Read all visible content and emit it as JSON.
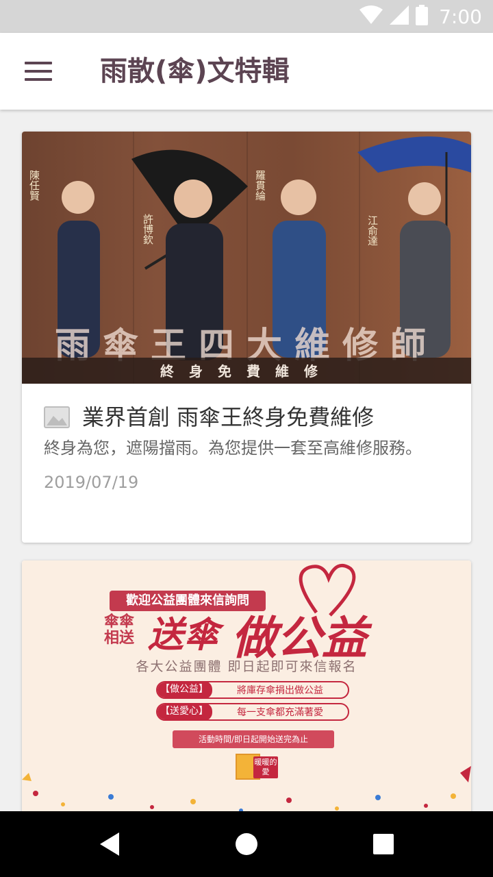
{
  "status_bar": {
    "time": "7:00",
    "icons": [
      "wifi-icon",
      "cellular-signal-icon",
      "battery-icon"
    ]
  },
  "app_bar": {
    "title": "雨散(傘)文特輯",
    "menu_icon": "hamburger-menu-icon"
  },
  "cards": [
    {
      "image_text": {
        "banner": "雨傘王四大維修師",
        "subtitle": "終身免費維修",
        "names": [
          "陳任賢",
          "許博欽",
          "羅貫綸",
          "江俞達"
        ]
      },
      "icon": "image-icon",
      "title": "業界首創 雨傘王終身免費維修",
      "description": "終身為您，遮陽擋雨。為您提供一套至高維修服務。",
      "date": "2019/07/19"
    },
    {
      "image_text": {
        "line1": "歡迎公益團體來信詢問",
        "small": "傘傘相送",
        "big1": "送傘",
        "big2": "做公益",
        "sub": "各大公益團體 即日起即可來信報名",
        "row1_tag": "【做公益】",
        "row1_text": "將庫存傘捐出做公益",
        "row2_tag": "【送愛心】",
        "row2_text": "每一支傘都充滿著愛",
        "ribbon": "活動時間/即日起開始送完為止",
        "gift": "暖暖的愛"
      }
    }
  ],
  "nav_bar": {
    "icons": [
      "back-icon",
      "home-icon",
      "recents-icon"
    ]
  },
  "colors": {
    "title": "#5c4452",
    "status_bar": "#d6d6d6",
    "accent_red": "#c4273f"
  }
}
